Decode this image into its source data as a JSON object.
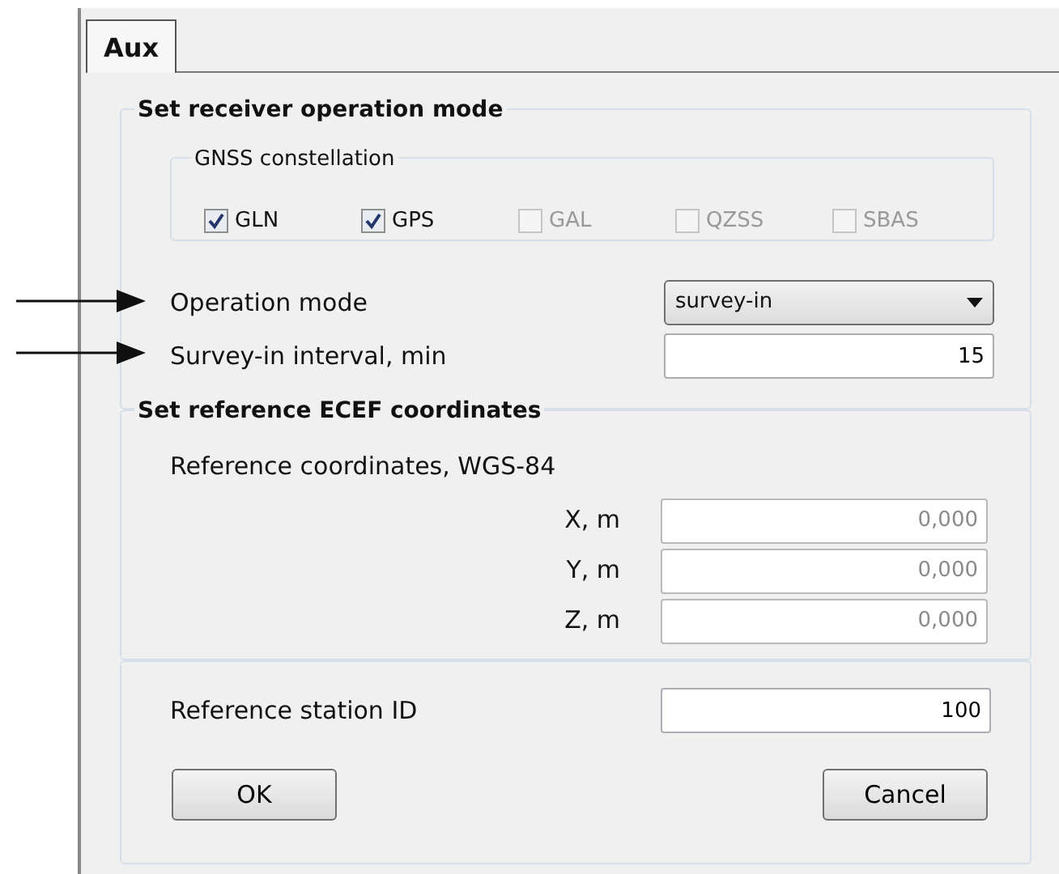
{
  "tabs": [
    {
      "label": "Aux",
      "selected": true
    }
  ],
  "operation_group": {
    "title": "Set receiver operation mode",
    "gnss": {
      "title": "GNSS constellation",
      "options": [
        {
          "label": "GLN",
          "checked": true,
          "disabled": false
        },
        {
          "label": "GPS",
          "checked": true,
          "disabled": false
        },
        {
          "label": "GAL",
          "checked": false,
          "disabled": true
        },
        {
          "label": "QZSS",
          "checked": false,
          "disabled": true
        },
        {
          "label": "SBAS",
          "checked": false,
          "disabled": true
        }
      ]
    },
    "operation_mode": {
      "label": "Operation mode",
      "value": "survey-in"
    },
    "survey_interval": {
      "label": "Survey-in interval, min",
      "value": "15"
    }
  },
  "reference_group": {
    "title": "Set reference ECEF coordinates",
    "subtitle": "Reference coordinates, WGS-84",
    "coordinates": [
      {
        "label": "X, m",
        "value": "0,000",
        "disabled": true
      },
      {
        "label": "Y, m",
        "value": "0,000",
        "disabled": true
      },
      {
        "label": "Z, m",
        "value": "0,000",
        "disabled": true
      }
    ]
  },
  "station": {
    "label": "Reference station ID",
    "value": "100"
  },
  "buttons": [
    "OK",
    "Cancel"
  ]
}
